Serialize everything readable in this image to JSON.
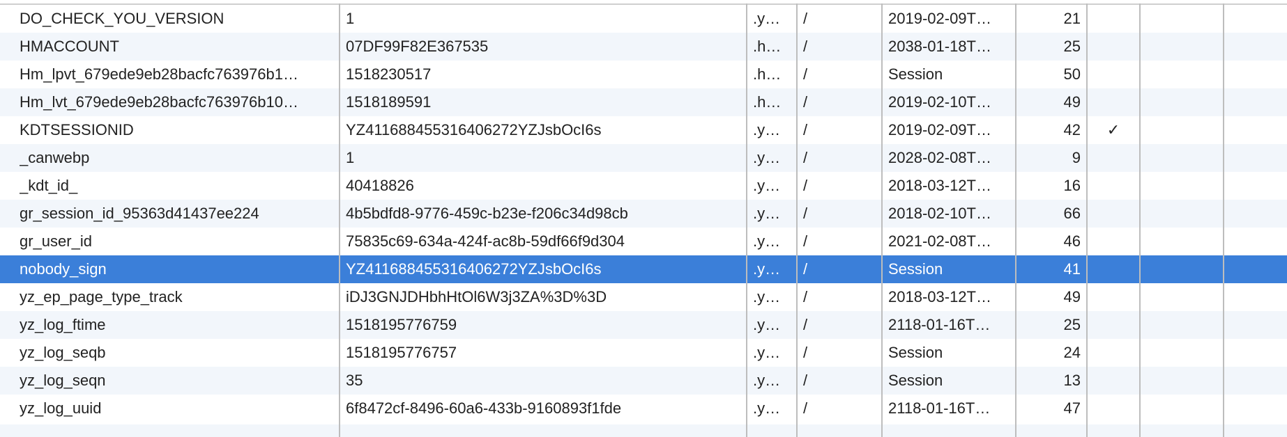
{
  "cookies": [
    {
      "name": "DO_CHECK_YOU_VERSION",
      "value": "1",
      "domain": ".y…",
      "path": "/",
      "expires": "2019-02-09T…",
      "size": "21",
      "http": ""
    },
    {
      "name": "HMACCOUNT",
      "value": "07DF99F82E367535",
      "domain": ".h…",
      "path": "/",
      "expires": "2038-01-18T…",
      "size": "25",
      "http": ""
    },
    {
      "name": "Hm_lpvt_679ede9eb28bacfc763976b1…",
      "value": "1518230517",
      "domain": ".h…",
      "path": "/",
      "expires": "Session",
      "size": "50",
      "http": ""
    },
    {
      "name": "Hm_lvt_679ede9eb28bacfc763976b10…",
      "value": "1518189591",
      "domain": ".h…",
      "path": "/",
      "expires": "2019-02-10T…",
      "size": "49",
      "http": ""
    },
    {
      "name": "KDTSESSIONID",
      "value": "YZ411688455316406272YZJsbOcI6s",
      "domain": ".y…",
      "path": "/",
      "expires": "2019-02-09T…",
      "size": "42",
      "http": "✓"
    },
    {
      "name": "_canwebp",
      "value": "1",
      "domain": ".y…",
      "path": "/",
      "expires": "2028-02-08T…",
      "size": "9",
      "http": ""
    },
    {
      "name": "_kdt_id_",
      "value": "40418826",
      "domain": ".y…",
      "path": "/",
      "expires": "2018-03-12T…",
      "size": "16",
      "http": ""
    },
    {
      "name": "gr_session_id_95363d41437ee224",
      "value": "4b5bdfd8-9776-459c-b23e-f206c34d98cb",
      "domain": ".y…",
      "path": "/",
      "expires": "2018-02-10T…",
      "size": "66",
      "http": ""
    },
    {
      "name": "gr_user_id",
      "value": "75835c69-634a-424f-ac8b-59df66f9d304",
      "domain": ".y…",
      "path": "/",
      "expires": "2021-02-08T…",
      "size": "46",
      "http": ""
    },
    {
      "name": "nobody_sign",
      "value": "YZ411688455316406272YZJsbOcI6s",
      "domain": ".y…",
      "path": "/",
      "expires": "Session",
      "size": "41",
      "http": "",
      "selected": true
    },
    {
      "name": "yz_ep_page_type_track",
      "value": "iDJ3GNJDHbhHtOl6W3j3ZA%3D%3D",
      "domain": ".y…",
      "path": "/",
      "expires": "2018-03-12T…",
      "size": "49",
      "http": ""
    },
    {
      "name": "yz_log_ftime",
      "value": "1518195776759",
      "domain": ".y…",
      "path": "/",
      "expires": "2118-01-16T…",
      "size": "25",
      "http": ""
    },
    {
      "name": "yz_log_seqb",
      "value": "1518195776757",
      "domain": ".y…",
      "path": "/",
      "expires": "Session",
      "size": "24",
      "http": ""
    },
    {
      "name": "yz_log_seqn",
      "value": "35",
      "domain": ".y…",
      "path": "/",
      "expires": "Session",
      "size": "13",
      "http": ""
    },
    {
      "name": "yz_log_uuid",
      "value": "6f8472cf-8496-60a6-433b-9160893f1fde",
      "domain": ".y…",
      "path": "/",
      "expires": "2118-01-16T…",
      "size": "47",
      "http": ""
    }
  ],
  "colors": {
    "selected_row": "#3b7fd9",
    "alt_row": "#f2f6fb",
    "grid_line": "#bdbdbd"
  }
}
